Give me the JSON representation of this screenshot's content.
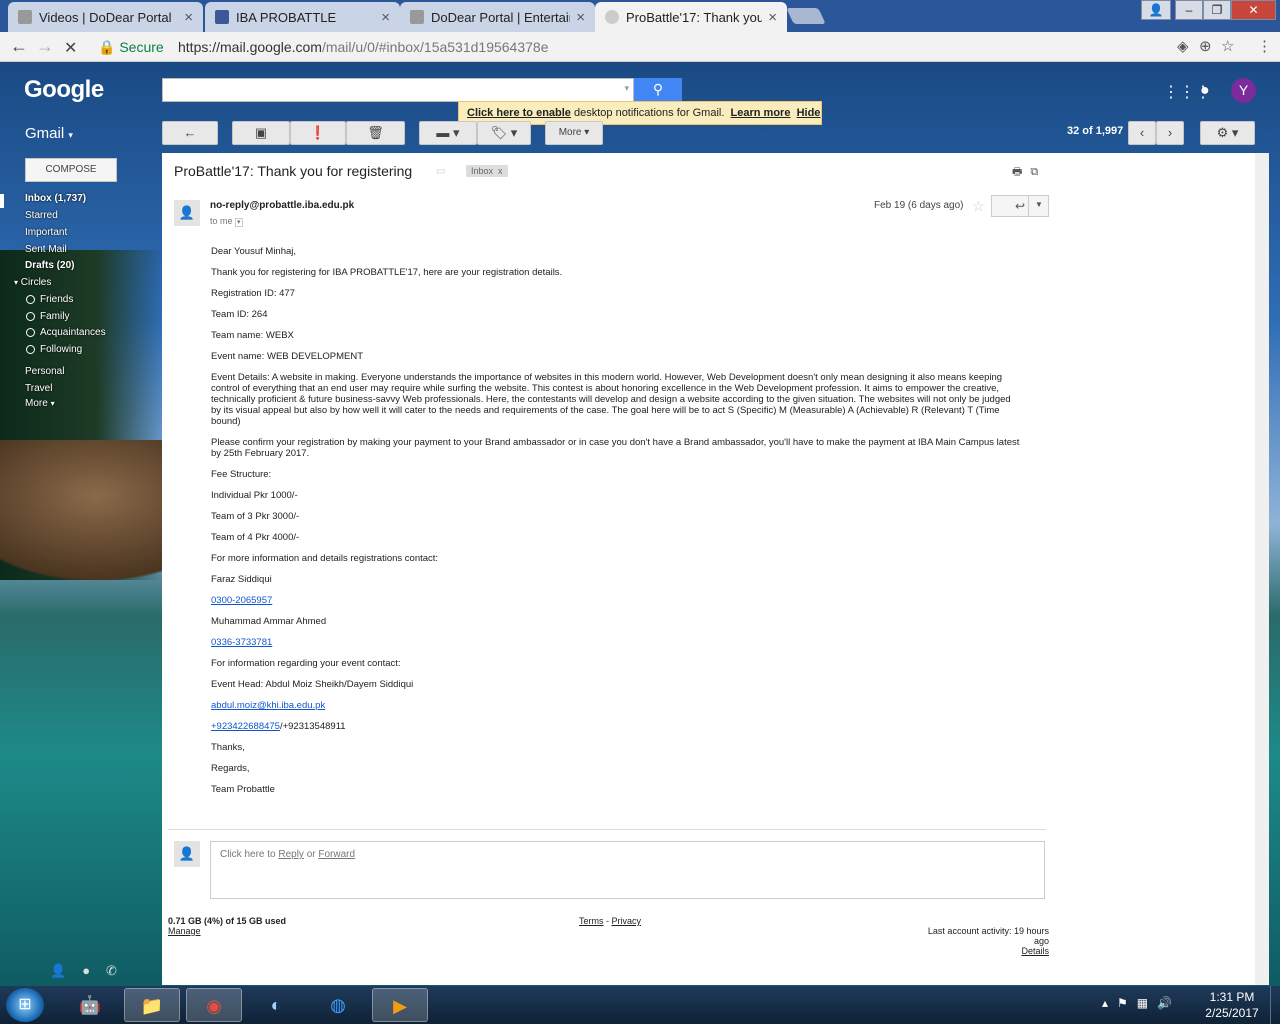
{
  "browser": {
    "tabs": [
      {
        "title": "Videos | DoDear Portal"
      },
      {
        "title": "IBA PROBATTLE"
      },
      {
        "title": "DoDear Portal | Entertain"
      },
      {
        "title": "ProBattle'17: Thank you f"
      }
    ],
    "secure_label": "Secure",
    "url_base": "https://mail.google.com",
    "url_path": "/mail/u/0/#inbox/15a531d19564378e"
  },
  "gmail": {
    "logo": "Google",
    "label": "Gmail",
    "notification": {
      "link": "Click here to enable",
      "text": " desktop notifications for Gmail.",
      "learn": "Learn more",
      "hide": "Hide"
    },
    "avatar_letter": "Y",
    "toolbar_more": "More",
    "pager": "32 of 1,997"
  },
  "sidebar": {
    "compose": "COMPOSE",
    "items": [
      {
        "label": "Inbox (1,737)"
      },
      {
        "label": "Starred"
      },
      {
        "label": "Important"
      },
      {
        "label": "Sent Mail"
      },
      {
        "label": "Drafts (20)"
      },
      {
        "label": "Circles"
      }
    ],
    "circles": [
      "Friends",
      "Family",
      "Acquaintances",
      "Following"
    ],
    "more_items": [
      "Personal",
      "Travel",
      "More"
    ]
  },
  "email": {
    "subject": "ProBattle'17: Thank you for registering",
    "label": "Inbox",
    "sender": "no-reply@probattle.iba.edu.pk",
    "to": "to me",
    "date": "Feb 19 (6 days ago)",
    "lines": [
      "Dear Yousuf Minhaj,",
      "Thank you for registering for IBA PROBATTLE'17, here are your registration details.",
      "Registration ID: 477",
      "Team ID: 264",
      "Team name: WEBX",
      "Event name: WEB DEVELOPMENT",
      "Event Details: A website in making. Everyone understands the importance of websites in this modern world. However, Web Development doesn't only mean designing it also means keeping control of everything that an end user may require while surfing the website. This contest is about honoring excellence in the Web Development profession. It aims to empower the creative, technically proficient & future business-savvy Web professionals. Here, the contestants will develop and design a website according to the given situation. The websites will not only be judged by its visual appeal but also by how well it will cater to the needs and requirements of the case. The goal here will be to act S (Specific) M (Measurable) A (Achievable) R (Relevant) T (Time bound)",
      "Please confirm your registration by making your payment to your Brand ambassador or in case you don't have a Brand ambassador, you'll have to make the payment at IBA Main Campus latest by 25th February 2017.",
      "Fee Structure:",
      "Individual Pkr 1000/-",
      "Team of 3 Pkr 3000/-",
      "Team of 4 Pkr 4000/-",
      "For more information and details registrations contact:",
      "Faraz Siddiqui"
    ],
    "phone1": "0300-2065957",
    "contact2": "Muhammad Ammar Ahmed",
    "phone2": "0336-3733781",
    "event_info": "For information regarding your event contact:",
    "event_head": "Event Head: Abdul Moiz Sheikh/Dayem Siddiqui",
    "email_link": "abdul.moiz@khi.iba.edu.pk",
    "phone3": "+923422688475",
    "phone4": "/+92313548911",
    "thanks": "Thanks,",
    "regards": "Regards,",
    "team": "Team Probattle"
  },
  "reply": {
    "prefix": "Click here to ",
    "reply": "Reply",
    "or": " or ",
    "forward": "Forward"
  },
  "footer": {
    "storage": "0.71 GB (4%) of 15 GB used",
    "manage": "Manage",
    "terms": "Terms",
    "sep": " - ",
    "privacy": "Privacy",
    "activity": "Last account activity: 19 hours ago",
    "details": "Details"
  },
  "taskbar": {
    "time": "1:31 PM",
    "date": "2/25/2017"
  }
}
